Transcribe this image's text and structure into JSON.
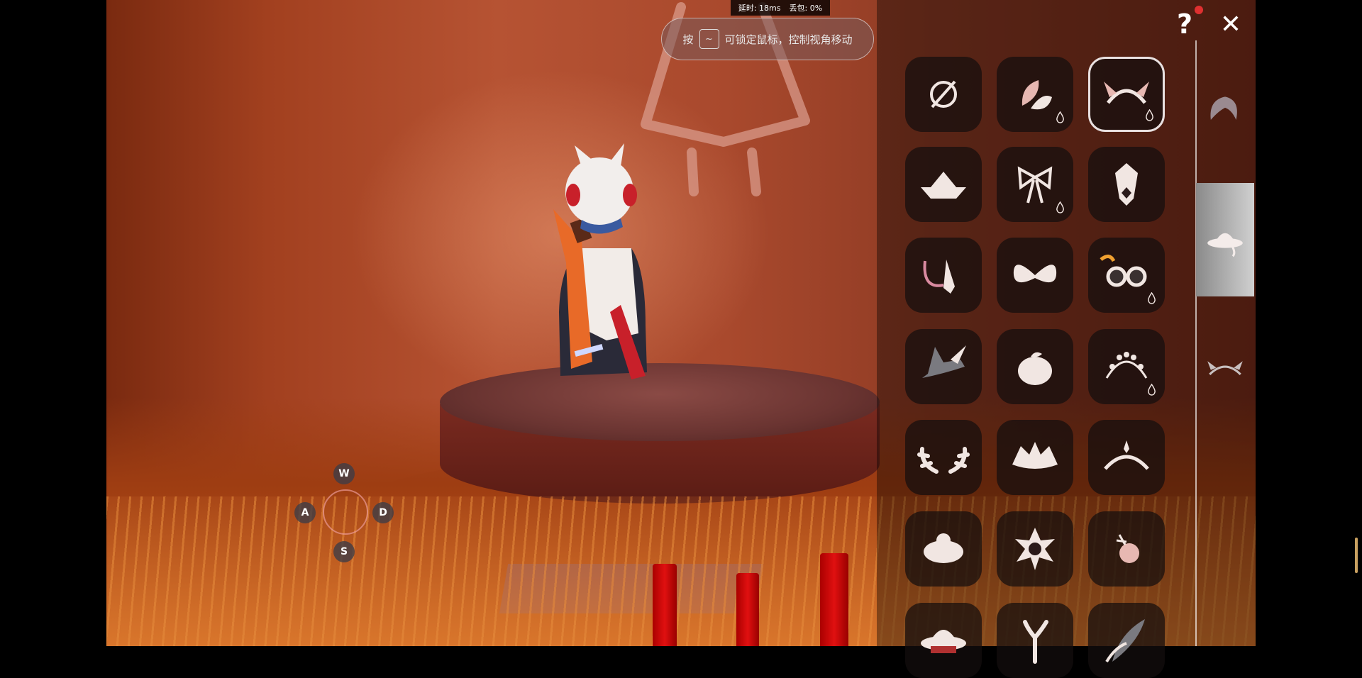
{
  "hud": {
    "latency_label": "延时: 18ms",
    "packet_loss_label": "丢包: 0%",
    "hint_prefix": "按",
    "hint_key": "~",
    "hint_text": "可锁定鼠标，控制视角移动"
  },
  "controls": {
    "w": "W",
    "a": "A",
    "s": "S",
    "d": "D"
  },
  "topbar": {
    "help_label": "?",
    "close_label": "✕"
  },
  "panel": {
    "items": [
      {
        "icon": "none-icon",
        "selected": false,
        "drop": false
      },
      {
        "icon": "petal-icon",
        "selected": false,
        "drop": true
      },
      {
        "icon": "horn-headband-icon",
        "selected": true,
        "drop": true
      },
      {
        "icon": "paper-boat-hat-icon",
        "selected": false,
        "drop": false
      },
      {
        "icon": "ribbon-bow-icon",
        "selected": false,
        "drop": true
      },
      {
        "icon": "crystal-icon",
        "selected": false,
        "drop": false
      },
      {
        "icon": "hanging-charm-icon",
        "selected": false,
        "drop": false
      },
      {
        "icon": "large-bow-icon",
        "selected": false,
        "drop": false
      },
      {
        "icon": "goggles-icon",
        "selected": false,
        "drop": true
      },
      {
        "icon": "witch-hat-icon",
        "selected": false,
        "drop": false
      },
      {
        "icon": "mandarin-orange-icon",
        "selected": false,
        "drop": false
      },
      {
        "icon": "flower-crown-icon",
        "selected": false,
        "drop": true
      },
      {
        "icon": "antlers-icon",
        "selected": false,
        "drop": false
      },
      {
        "icon": "jester-hat-icon",
        "selected": false,
        "drop": false
      },
      {
        "icon": "tiara-icon",
        "selected": false,
        "drop": false
      },
      {
        "icon": "bun-hat-icon",
        "selected": false,
        "drop": false
      },
      {
        "icon": "star-badge-icon",
        "selected": false,
        "drop": false
      },
      {
        "icon": "rose-icon",
        "selected": false,
        "drop": false
      },
      {
        "icon": "sun-hat-icon",
        "selected": false,
        "drop": false
      },
      {
        "icon": "branch-icon",
        "selected": false,
        "drop": false
      },
      {
        "icon": "feather-icon",
        "selected": false,
        "drop": false
      }
    ],
    "categories": [
      {
        "icon": "hair-icon",
        "active": false
      },
      {
        "icon": "hat-icon",
        "active": true
      },
      {
        "icon": "horns-icon",
        "active": false
      }
    ]
  }
}
